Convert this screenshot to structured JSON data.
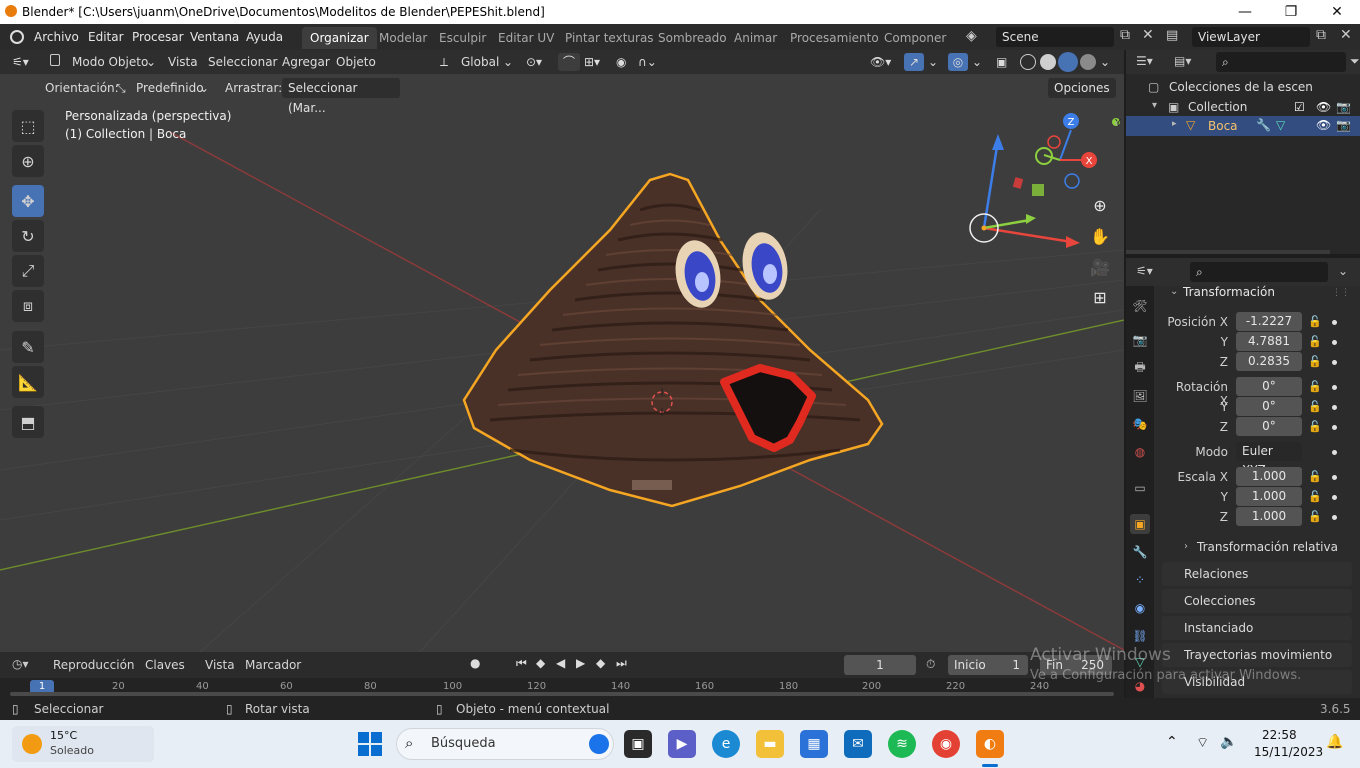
{
  "window": {
    "title": "Blender* [C:\\Users\\juanm\\OneDrive\\Documentos\\Modelitos de Blender\\PEPEShit.blend]",
    "minimize": "—",
    "maximize": "❐",
    "close": "✕"
  },
  "menu": [
    "Archivo",
    "Editar",
    "Procesar",
    "Ventana",
    "Ayuda"
  ],
  "workspaces": [
    "Organizar",
    "Modelar",
    "Esculpir",
    "Editar UV",
    "Pintar texturas",
    "Sombreado",
    "Animar",
    "Procesamiento",
    "Componer"
  ],
  "active_workspace": "Organizar",
  "scene": {
    "label": "Scene",
    "viewlayer": "ViewLayer"
  },
  "viewport_header": {
    "mode": "Modo Objeto",
    "menus": [
      "Vista",
      "Seleccionar",
      "Agregar",
      "Objeto"
    ],
    "transform_orientation": "Global"
  },
  "tool_settings": {
    "orientation_label": "Orientación:",
    "orientation_value": "Predefinido",
    "drag_label": "Arrastrar:",
    "drag_value": "Seleccionar (Mar...",
    "options": "Opciones"
  },
  "viewport_overlay": {
    "view_name": "Personalizada (perspectiva)",
    "collection_info": "(1) Collection | Boca"
  },
  "gizmo": {
    "z": "Z",
    "y": "Y",
    "x": "X"
  },
  "watermark": {
    "line1": "Activar Windows",
    "line2": "Ve a Configuración para activar Windows."
  },
  "outliner": {
    "root": "Colecciones de la escen",
    "collection": "Collection",
    "object": "Boca"
  },
  "properties": {
    "section": "Transformación",
    "position_label": "Posición X",
    "position": {
      "x": "-1.2227",
      "y": "4.7881",
      "z": "0.2835"
    },
    "rotation_label": "Rotación X",
    "rotation": {
      "x": "0°",
      "y": "0°",
      "z": "0°"
    },
    "mode_label": "Modo",
    "mode_value": "Euler XYZ",
    "scale_label": "Escala X",
    "scale": {
      "x": "1.000",
      "y": "1.000",
      "z": "1.000"
    },
    "axis_y": "Y",
    "axis_z": "Z",
    "subsection": "Transformación relativa",
    "panels": [
      "Relaciones",
      "Colecciones",
      "Instanciado",
      "Trayectorias movimiento",
      "Visibilidad"
    ]
  },
  "timeline": {
    "menus": [
      "Reproducción",
      "Claves",
      "Vista",
      "Marcador"
    ],
    "current_frame": "1",
    "start_label": "Inicio",
    "start": "1",
    "end_label": "Fin",
    "end": "250",
    "ruler": [
      "1",
      "20",
      "40",
      "60",
      "80",
      "100",
      "120",
      "140",
      "160",
      "180",
      "200",
      "220",
      "240"
    ]
  },
  "statusbar": {
    "select": "Seleccionar",
    "rotate": "Rotar vista",
    "context": "Objeto - menú contextual",
    "version": "3.6.5"
  },
  "taskbar": {
    "weather_temp": "15°C",
    "weather_desc": "Soleado",
    "search": "Búsqueda",
    "time": "22:58",
    "date": "15/11/2023"
  },
  "colors": {
    "accent": "#4772b3",
    "selection_outline": "#f5a623",
    "x_axis": "#e8453c",
    "y_axis": "#8ccf3f",
    "z_axis": "#3c7de8"
  }
}
